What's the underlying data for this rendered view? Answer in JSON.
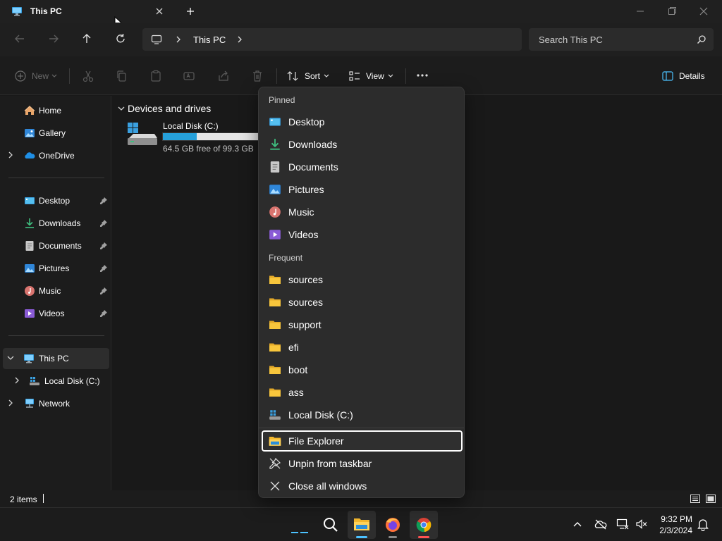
{
  "window": {
    "tab_title": "This PC"
  },
  "address_bar": {
    "crumb": "This PC",
    "search_placeholder": "Search This PC"
  },
  "command_bar": {
    "new_label": "New",
    "sort_label": "Sort",
    "view_label": "View",
    "details_label": "Details"
  },
  "sidebar": {
    "top": [
      {
        "label": "Home",
        "icon": "home-icon"
      },
      {
        "label": "Gallery",
        "icon": "gallery-icon"
      },
      {
        "label": "OneDrive",
        "icon": "onedrive-icon"
      }
    ],
    "pinned": [
      {
        "label": "Desktop",
        "icon": "desktop-icon"
      },
      {
        "label": "Downloads",
        "icon": "downloads-icon"
      },
      {
        "label": "Documents",
        "icon": "documents-icon"
      },
      {
        "label": "Pictures",
        "icon": "pictures-icon"
      },
      {
        "label": "Music",
        "icon": "music-icon"
      },
      {
        "label": "Videos",
        "icon": "videos-icon"
      }
    ],
    "tree": [
      {
        "label": "This PC",
        "icon": "this-pc-icon"
      },
      {
        "label": "Local Disk (C:)",
        "icon": "local-disk-icon"
      },
      {
        "label": "Network",
        "icon": "network-icon"
      }
    ]
  },
  "content": {
    "group_title": "Devices and drives",
    "drive": {
      "name": "Local Disk (C:)",
      "free_text": "64.5 GB free of 99.3 GB",
      "used_fraction": 0.35
    }
  },
  "status_bar": {
    "items_text": "2 items"
  },
  "jump_list": {
    "pinned_header": "Pinned",
    "pinned": [
      {
        "label": "Desktop",
        "icon": "desktop-icon"
      },
      {
        "label": "Downloads",
        "icon": "downloads-icon"
      },
      {
        "label": "Documents",
        "icon": "documents-icon"
      },
      {
        "label": "Pictures",
        "icon": "pictures-icon"
      },
      {
        "label": "Music",
        "icon": "music-icon"
      },
      {
        "label": "Videos",
        "icon": "videos-icon"
      }
    ],
    "frequent_header": "Frequent",
    "frequent": [
      {
        "label": "sources",
        "icon": "folder-icon"
      },
      {
        "label": "sources",
        "icon": "folder-icon"
      },
      {
        "label": "support",
        "icon": "folder-icon"
      },
      {
        "label": "efi",
        "icon": "folder-icon"
      },
      {
        "label": "boot",
        "icon": "folder-icon"
      },
      {
        "label": "ass",
        "icon": "folder-icon"
      },
      {
        "label": "Local Disk (C:)",
        "icon": "local-disk-icon"
      }
    ],
    "actions": [
      {
        "label": "File Explorer",
        "icon": "file-explorer-icon"
      },
      {
        "label": "Unpin from taskbar",
        "icon": "unpin-icon"
      },
      {
        "label": "Close all windows",
        "icon": "close-icon"
      }
    ]
  },
  "taskbar": {
    "time": "9:32 PM",
    "date": "2/3/2024"
  },
  "colors": {
    "accent": "#4cc2ff",
    "folder": "#f8c63c",
    "drive_bar": "#26a0da"
  }
}
